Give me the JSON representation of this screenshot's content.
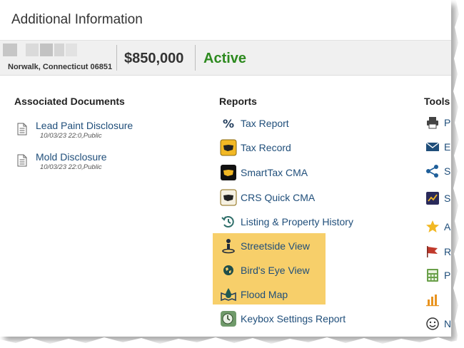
{
  "header": {
    "title": "Additional Information"
  },
  "listing": {
    "address": "Norwalk, Connecticut 06851",
    "price": "$850,000",
    "status": "Active"
  },
  "colors": {
    "status_green": "#2d8a1f",
    "link_blue": "#1f4e7a",
    "highlight": "#f7cf6a"
  },
  "documents": {
    "title": "Associated Documents",
    "items": [
      {
        "label": "Lead Paint Disclosure",
        "meta": "10/03/23 22:0,Public",
        "icon": "document-icon"
      },
      {
        "label": "Mold Disclosure",
        "meta": "10/03/23 22:0,Public",
        "icon": "document-icon"
      }
    ]
  },
  "reports": {
    "title": "Reports",
    "items": [
      {
        "label": "Tax Report",
        "icon": "percent-icon"
      },
      {
        "label": "Tax Record",
        "icon": "tax-record-icon"
      },
      {
        "label": "SmartTax CMA",
        "icon": "smarttax-icon"
      },
      {
        "label": "CRS Quick CMA",
        "icon": "crs-cma-icon"
      },
      {
        "label": "Listing & Property History",
        "icon": "history-icon"
      },
      {
        "label": "Streetside View",
        "icon": "streetside-icon"
      },
      {
        "label": "Bird's Eye View",
        "icon": "globe-icon"
      },
      {
        "label": "Flood Map",
        "icon": "flood-map-icon"
      },
      {
        "label": "Keybox Settings Report",
        "icon": "keybox-icon"
      }
    ]
  },
  "tools": {
    "title": "Tools",
    "items": [
      {
        "label": "P",
        "icon": "print-icon"
      },
      {
        "label": "Em",
        "icon": "email-icon"
      },
      {
        "label": "Sh",
        "icon": "share-icon"
      },
      {
        "label": "S",
        "icon": "stats-icon"
      },
      {
        "label": "Ac",
        "icon": "star-icon"
      },
      {
        "label": "R",
        "icon": "flag-icon"
      },
      {
        "label": "Pa",
        "icon": "calculator-icon"
      },
      {
        "label": "",
        "icon": "chart-icon"
      },
      {
        "label": "Na",
        "icon": "smiley-icon"
      }
    ]
  }
}
